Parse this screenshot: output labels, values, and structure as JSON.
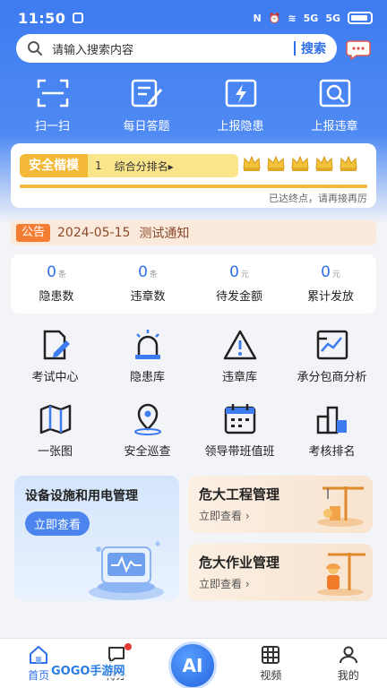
{
  "status_bar": {
    "time": "11:50",
    "signal1": "5G",
    "signal2": "5G"
  },
  "search": {
    "placeholder": "请输入搜索内容",
    "button": "搜索"
  },
  "quick_actions": [
    {
      "label": "扫一扫",
      "icon": "scan-icon"
    },
    {
      "label": "每日答题",
      "icon": "quiz-icon"
    },
    {
      "label": "上报隐患",
      "icon": "hazard-report-icon"
    },
    {
      "label": "上报违章",
      "icon": "violation-report-icon"
    }
  ],
  "rank": {
    "badge": "安全楷模",
    "level": "1",
    "text": "综合分排名▸",
    "stars": 5,
    "progress": 1.0,
    "hint": "已达终点，请再接再厉"
  },
  "notice": {
    "tag": "公告",
    "date": "2024-05-15",
    "text": "测试通知"
  },
  "stats": [
    {
      "value": "0",
      "unit": "条",
      "label": "隐患数"
    },
    {
      "value": "0",
      "unit": "条",
      "label": "违章数"
    },
    {
      "value": "0",
      "unit": "元",
      "label": "待发金额"
    },
    {
      "value": "0",
      "unit": "元",
      "label": "累计发放"
    }
  ],
  "grid": [
    {
      "label": "考试中心",
      "icon": "exam-icon"
    },
    {
      "label": "隐患库",
      "icon": "alarm-light-icon"
    },
    {
      "label": "违章库",
      "icon": "warning-icon"
    },
    {
      "label": "承分包商分析",
      "icon": "chart-icon"
    },
    {
      "label": "一张图",
      "icon": "map-icon"
    },
    {
      "label": "安全巡查",
      "icon": "location-icon"
    },
    {
      "label": "领导带班值班",
      "icon": "calendar-icon"
    },
    {
      "label": "考核排名",
      "icon": "ranking-icon"
    }
  ],
  "cards": {
    "big": {
      "title": "设备设施和用电管理",
      "button": "立即查看"
    },
    "small1": {
      "title": "危大工程管理",
      "link": "立即查看 ›"
    },
    "small2": {
      "title": "危大作业管理",
      "link": "立即查看 ›"
    }
  },
  "tabs": [
    {
      "label": "首页",
      "icon": "home-icon"
    },
    {
      "label": "待办",
      "icon": "message-icon"
    },
    {
      "label": "AI",
      "icon": "ai-icon"
    },
    {
      "label": "视频",
      "icon": "video-icon"
    },
    {
      "label": "我的",
      "icon": "user-icon"
    }
  ],
  "watermark": "GOGO手游网",
  "colors": {
    "primary": "#2f6fe8",
    "gold": "#f2b836",
    "notice": "#f47d34"
  }
}
